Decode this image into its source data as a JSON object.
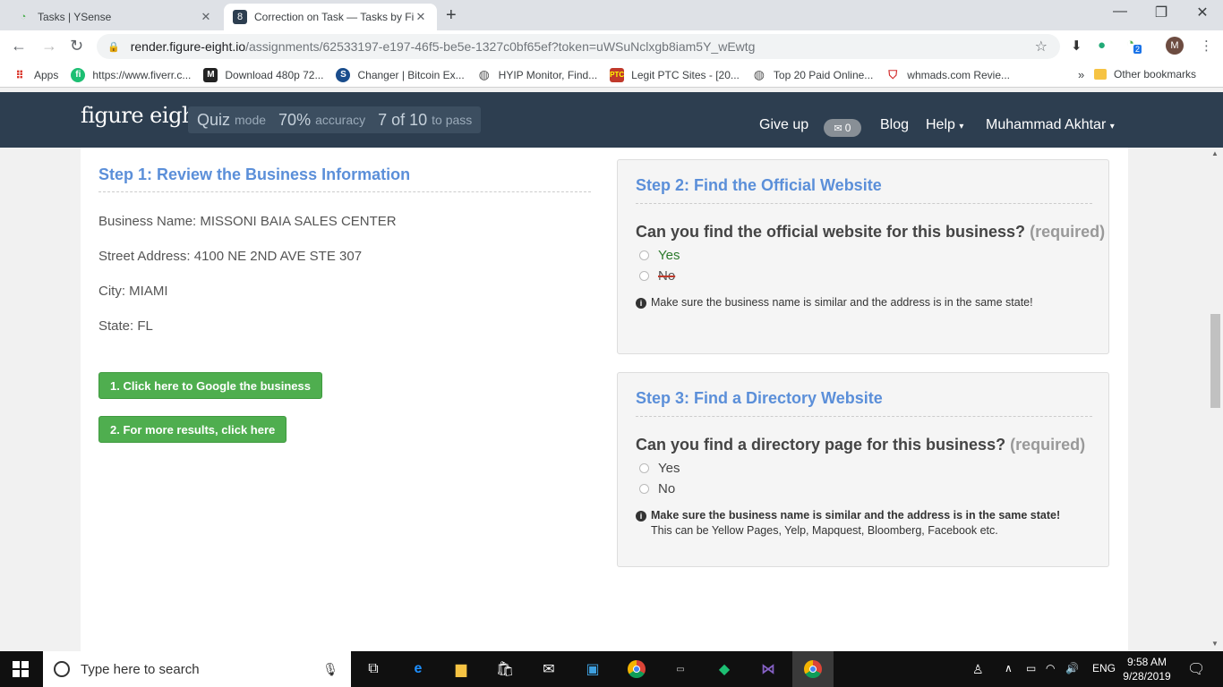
{
  "browser": {
    "tabs": [
      {
        "title": "Tasks | YSense",
        "close": "✕"
      },
      {
        "title": "Correction on Task — Tasks by Fi",
        "close": "✕"
      }
    ],
    "new_tab": "+",
    "window_controls": {
      "minimize": "—",
      "maximize": "❐",
      "close": "✕"
    },
    "url_host": "render.figure-eight.io",
    "url_path": "/assignments/62533197-e197-46f5-be5e-1327c0bf65ef?token=uWSuNclxgb8iam5Y_wEwtg",
    "profile_initial": "M",
    "extension_badge": "2",
    "bookmarks": [
      {
        "label": "Apps",
        "icon": "apps-grid-icon"
      },
      {
        "label": "https://www.fiverr.c...",
        "icon": "fiverr-icon"
      },
      {
        "label": "Download 480p 72...",
        "icon": "mkv-icon"
      },
      {
        "label": "Changer | Bitcoin Ex...",
        "icon": "changer-icon"
      },
      {
        "label": "HYIP Monitor, Find...",
        "icon": "globe-icon"
      },
      {
        "label": "Legit PTC Sites - [20...",
        "icon": "ptc-icon"
      },
      {
        "label": "Top 20 Paid Online...",
        "icon": "globe-icon"
      },
      {
        "label": "whmads.com Revie...",
        "icon": "shield-icon"
      }
    ],
    "bookmarks_more": "»",
    "other_bookmarks": "Other bookmarks"
  },
  "header": {
    "logo": "figure eight",
    "quiz": {
      "mode": "Quiz",
      "mode_suffix": "mode",
      "accuracy": "70%",
      "accuracy_suffix": "accuracy",
      "progress": "7 of 10",
      "progress_suffix": "to pass"
    },
    "give_up": "Give up",
    "mail_count": "0",
    "blog": "Blog",
    "help": "Help",
    "user": "Muhammad Akhtar"
  },
  "step1": {
    "title": "Step 1: Review the Business Information",
    "business_name": "Business Name: MISSONI BAIA SALES CENTER",
    "street_address": "Street Address: 4100 NE 2ND AVE STE 307",
    "city": "City: MIAMI",
    "state": "State: FL",
    "google_button": "1. Click here to Google the business",
    "more_button": "2. For more results, click here"
  },
  "step2": {
    "title": "Step 2: Find the Official Website",
    "question": "Can you find the official website for this business?",
    "required": "(required)",
    "options": [
      "Yes",
      "No"
    ],
    "note": "Make sure the business name is similar and the address is in the same state!"
  },
  "step3": {
    "title": "Step 3: Find a Directory Website",
    "question": "Can you find a directory page for this business?",
    "required": "(required)",
    "options": [
      "Yes",
      "No"
    ],
    "note": "Make sure the business name is similar and the address is in the same state!",
    "note_sub": "This can be Yellow Pages, Yelp, Mapquest, Bloomberg, Facebook etc."
  },
  "taskbar": {
    "search_placeholder": "Type here to search",
    "language": "ENG",
    "time": "9:58 AM",
    "date": "9/28/2019"
  }
}
